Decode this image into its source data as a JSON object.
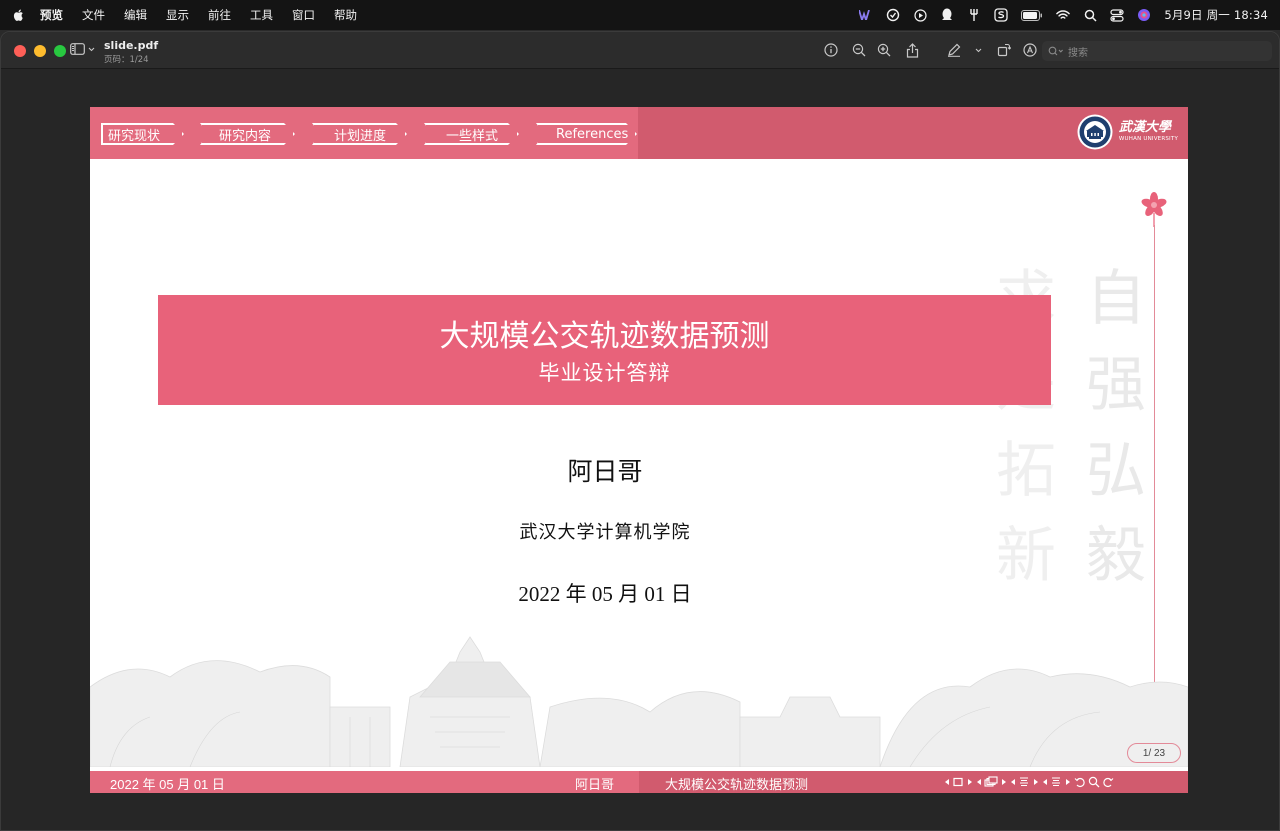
{
  "menubar": {
    "items": [
      "预览",
      "文件",
      "编辑",
      "显示",
      "前往",
      "工具",
      "窗口",
      "帮助"
    ],
    "clock": "5月9日 周一  18:34",
    "status_icons": [
      "w-app-icon",
      "grammar-icon",
      "play-icon",
      "qq-icon",
      "fork-icon",
      "s-app-icon",
      "battery-icon",
      "wifi-icon",
      "search-icon",
      "control-center-icon",
      "siri-icon"
    ]
  },
  "window": {
    "file_name": "slide.pdf",
    "page_label": "页码：1/24",
    "search_placeholder": "搜索"
  },
  "slide": {
    "nav_tabs": [
      "研究现状",
      "研究内容",
      "计划进度",
      "一些样式",
      "References"
    ],
    "logo_cn": "武漢大學",
    "logo_en": "WUHAN UNIVERSITY",
    "title": "大规模公交轨迹数据预测",
    "subtitle": "毕业设计答辩",
    "author": "阿日哥",
    "institute": "武汉大学计算机学院",
    "date": "2022 年 05 月 01 日",
    "watermark_col1": "自强弘毅",
    "watermark_col2": "求是拓新",
    "page_indicator": "1/ 23",
    "footer_date": "2022 年 05 月 01 日",
    "footer_author": "阿日哥",
    "footer_title": "大规模公交轨迹数据预测"
  },
  "colors": {
    "accent_pink": "#e36a7e",
    "accent_dark": "#d15b6e",
    "title_box": "#e8627a"
  }
}
